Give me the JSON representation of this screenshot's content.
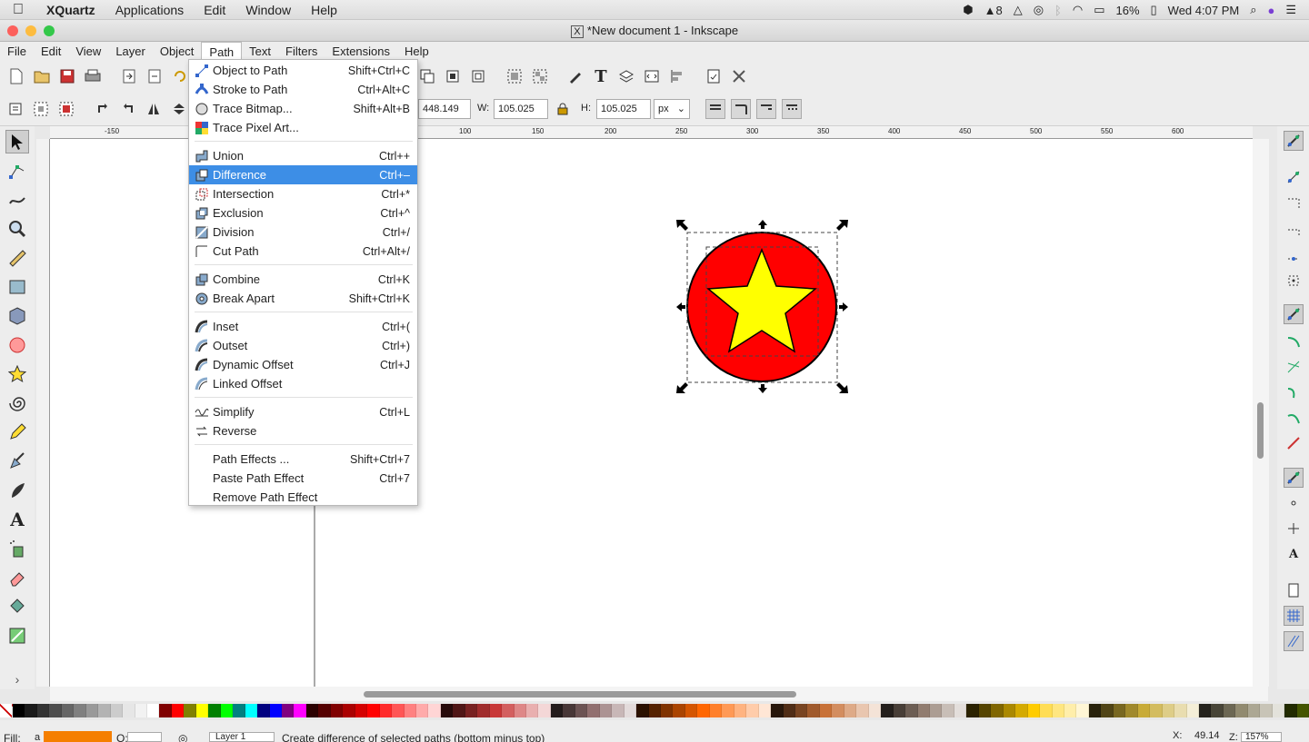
{
  "mac_menubar": {
    "app": "XQuartz",
    "items": [
      "Applications",
      "Edit",
      "Window",
      "Help"
    ],
    "badge_count": "8",
    "battery": "16%",
    "clock": "Wed 4:07 PM"
  },
  "window": {
    "title": "*New document 1 - Inkscape"
  },
  "app_menu": [
    "File",
    "Edit",
    "View",
    "Layer",
    "Object",
    "Path",
    "Text",
    "Filters",
    "Extensions",
    "Help"
  ],
  "path_menu": {
    "groups": [
      [
        {
          "label": "Object to Path",
          "shortcut": "Shift+Ctrl+C",
          "icon": "object-to-path-icon"
        },
        {
          "label": "Stroke to Path",
          "shortcut": "Ctrl+Alt+C",
          "icon": "stroke-to-path-icon"
        },
        {
          "label": "Trace Bitmap...",
          "shortcut": "Shift+Alt+B",
          "icon": "trace-bitmap-icon"
        },
        {
          "label": "Trace Pixel Art...",
          "shortcut": "",
          "icon": "trace-pixel-art-icon"
        }
      ],
      [
        {
          "label": "Union",
          "shortcut": "Ctrl++",
          "icon": "union-icon"
        },
        {
          "label": "Difference",
          "shortcut": "Ctrl+–",
          "icon": "difference-icon",
          "highlighted": true
        },
        {
          "label": "Intersection",
          "shortcut": "Ctrl+*",
          "icon": "intersection-icon"
        },
        {
          "label": "Exclusion",
          "shortcut": "Ctrl+^",
          "icon": "exclusion-icon"
        },
        {
          "label": "Division",
          "shortcut": "Ctrl+/",
          "icon": "division-icon"
        },
        {
          "label": "Cut Path",
          "shortcut": "Ctrl+Alt+/",
          "icon": "cut-path-icon"
        }
      ],
      [
        {
          "label": "Combine",
          "shortcut": "Ctrl+K",
          "icon": "combine-icon"
        },
        {
          "label": "Break Apart",
          "shortcut": "Shift+Ctrl+K",
          "icon": "break-apart-icon"
        }
      ],
      [
        {
          "label": "Inset",
          "shortcut": "Ctrl+(",
          "icon": "inset-icon"
        },
        {
          "label": "Outset",
          "shortcut": "Ctrl+)",
          "icon": "outset-icon"
        },
        {
          "label": "Dynamic Offset",
          "shortcut": "Ctrl+J",
          "icon": "dynamic-offset-icon"
        },
        {
          "label": "Linked Offset",
          "shortcut": "",
          "icon": "linked-offset-icon"
        }
      ],
      [
        {
          "label": "Simplify",
          "shortcut": "Ctrl+L",
          "icon": "simplify-icon"
        },
        {
          "label": "Reverse",
          "shortcut": "",
          "icon": "reverse-icon"
        }
      ],
      [
        {
          "label": "Path Effects ...",
          "shortcut": "Shift+Ctrl+7",
          "icon": ""
        },
        {
          "label": "Paste Path Effect",
          "shortcut": "Ctrl+7",
          "icon": ""
        },
        {
          "label": "Remove Path Effect",
          "shortcut": "",
          "icon": ""
        }
      ]
    ]
  },
  "controls": {
    "x_value": "448.149",
    "w_label": "W:",
    "w_value": "105.025",
    "h_label": "H:",
    "h_value": "105.025",
    "unit": "px"
  },
  "ruler_labels": [
    "-150",
    "100",
    "150",
    "200",
    "250",
    "300",
    "350",
    "400",
    "450",
    "500",
    "550",
    "600"
  ],
  "status": {
    "fill_label": "Fill:",
    "fill_color": "#f57f00",
    "layer": "Layer 1",
    "message": "Create difference of selected paths (bottom minus top)",
    "x_label": "X:",
    "x_value": "49.14",
    "z_label": "Z:",
    "zoom": "157%"
  },
  "drawing": {
    "circle_fill": "#ff0000",
    "star_fill": "#ffff00"
  },
  "palette": [
    "#000000",
    "#1a1a1a",
    "#333333",
    "#4d4d4d",
    "#666666",
    "#808080",
    "#999999",
    "#b3b3b3",
    "#cccccc",
    "#e6e6e6",
    "#f2f2f2",
    "#ffffff",
    "#800000",
    "#ff0000",
    "#808000",
    "#ffff00",
    "#008000",
    "#00ff00",
    "#008080",
    "#00ffff",
    "#000080",
    "#0000ff",
    "#800080",
    "#ff00ff",
    "#2b0000",
    "#550000",
    "#800000",
    "#aa0000",
    "#d40000",
    "#ff0000",
    "#ff2a2a",
    "#ff5555",
    "#ff8080",
    "#ffaaaa",
    "#ffd5d5",
    "#280b0b",
    "#501616",
    "#782121",
    "#a02c2c",
    "#c83737",
    "#d35f5f",
    "#de8787",
    "#e9afaf",
    "#f4d7d7",
    "#241c1c",
    "#483737",
    "#6c5353",
    "#916f6f",
    "#ac9393",
    "#c8b7b7",
    "#e3dbdb",
    "#2b1100",
    "#552200",
    "#803300",
    "#aa4400",
    "#d45500",
    "#ff6600",
    "#ff7f2a",
    "#ff9955",
    "#ffb380",
    "#ffccaa",
    "#ffe6d5",
    "#28170b",
    "#502d16",
    "#784421",
    "#a05a2c",
    "#c87137",
    "#d38d5f",
    "#deaa87",
    "#e9c6af",
    "#f4e3d7",
    "#241f1c",
    "#483e37",
    "#6c5d53",
    "#917c6f",
    "#ac9d93",
    "#c8beb7",
    "#e3dedb",
    "#2b2200",
    "#554400",
    "#806600",
    "#aa8800",
    "#d4aa00",
    "#ffcc00",
    "#ffdd55",
    "#ffe680",
    "#ffeeaa",
    "#fff6d5",
    "#28220b",
    "#504416",
    "#786721",
    "#a0892c",
    "#c8ab37",
    "#d3bc5f",
    "#decd87",
    "#e9ddaf",
    "#f4eed7",
    "#24221c",
    "#484537",
    "#6c6753",
    "#918a6f",
    "#aca793",
    "#c8c4b7",
    "#e3e2db",
    "#222b00",
    "#445500"
  ]
}
